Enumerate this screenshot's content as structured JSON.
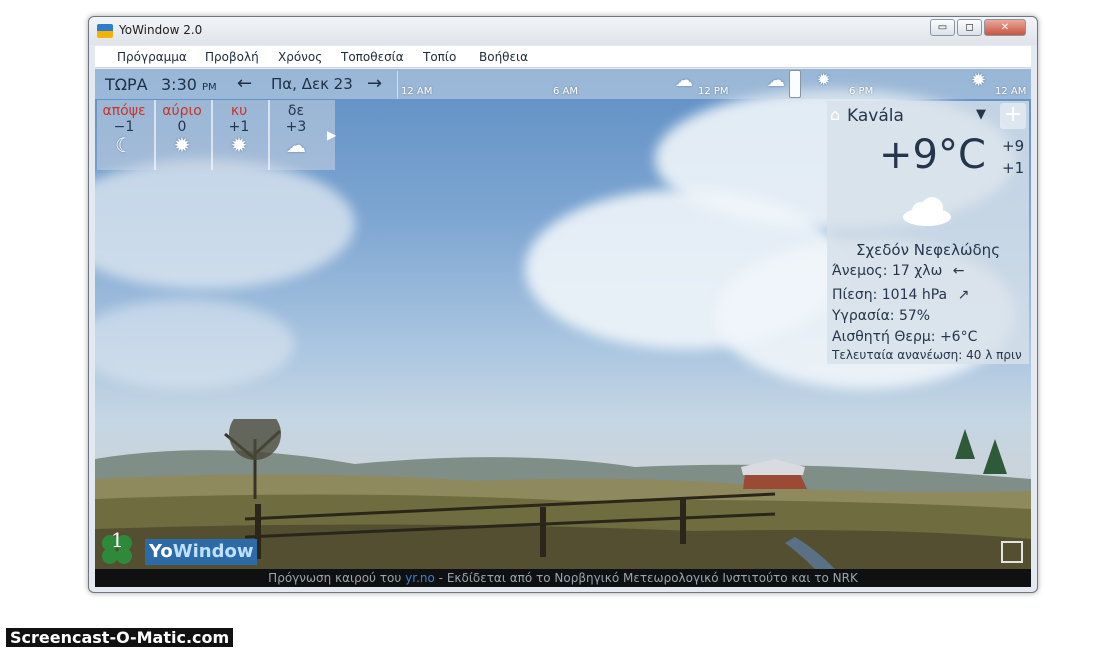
{
  "window": {
    "title": "YoWindow 2.0",
    "min_label": "▭",
    "max_label": "◻",
    "close_label": "✕"
  },
  "menu": [
    "Πρόγραμμα",
    "Προβολή",
    "Χρόνος",
    "Τοποθεσία",
    "Τοπίο",
    "Βοήθεια"
  ],
  "timebar": {
    "now_label": "ΤΩΡΑ",
    "time": "3:30",
    "ampm": "PM",
    "prev_arrow": "←",
    "next_arrow": "→",
    "date": "Πα, Δεκ 23",
    "ticks": [
      "12 AM",
      "6 AM",
      "12 PM",
      "6 PM",
      "12 AM"
    ]
  },
  "forecast": [
    {
      "day": "απόψε",
      "temp": "−1",
      "icon": "moon-icon",
      "glyph": "☾",
      "color": "red"
    },
    {
      "day": "αύριο",
      "temp": "0",
      "icon": "sun-icon",
      "glyph": "✹",
      "color": "red"
    },
    {
      "day": "κυ",
      "temp": "+1",
      "icon": "sun-icon",
      "glyph": "✹",
      "color": "red"
    },
    {
      "day": "δε",
      "temp": "+3",
      "icon": "cloud-icon",
      "glyph": "☁",
      "color": "dark"
    }
  ],
  "panel": {
    "city": "Kavála",
    "temp": "+9°C",
    "high": "+9",
    "low": "+1",
    "condition": "Σχεδόν Νεφελώδης",
    "wind_label": "Άνεμος:",
    "wind_value": "17 χλω",
    "wind_arrow": "←",
    "pressure_label": "Πίεση:",
    "pressure_value": "1014 hPa",
    "pressure_arrow": "↗",
    "humidity_label": "Υγρασία:",
    "humidity_value": "57%",
    "feels_label": "Αισθητή Θερμ:",
    "feels_value": "+6°C",
    "updated_label": "Τελευταία ανανέωση:",
    "updated_value": "40 λ πριν"
  },
  "branding": {
    "badge_number": "1",
    "logo_yo": "Yo",
    "logo_rest": "Window"
  },
  "footer": {
    "prefix": "Πρόγνωση καιρού του",
    "link": "yr.no",
    "suffix": "- Εκδίδεται από το Νορβηγικό Μετεωρολογικό Ινστιτούτο και το NRK"
  },
  "watermark": "Screencast-O-Matic.com"
}
